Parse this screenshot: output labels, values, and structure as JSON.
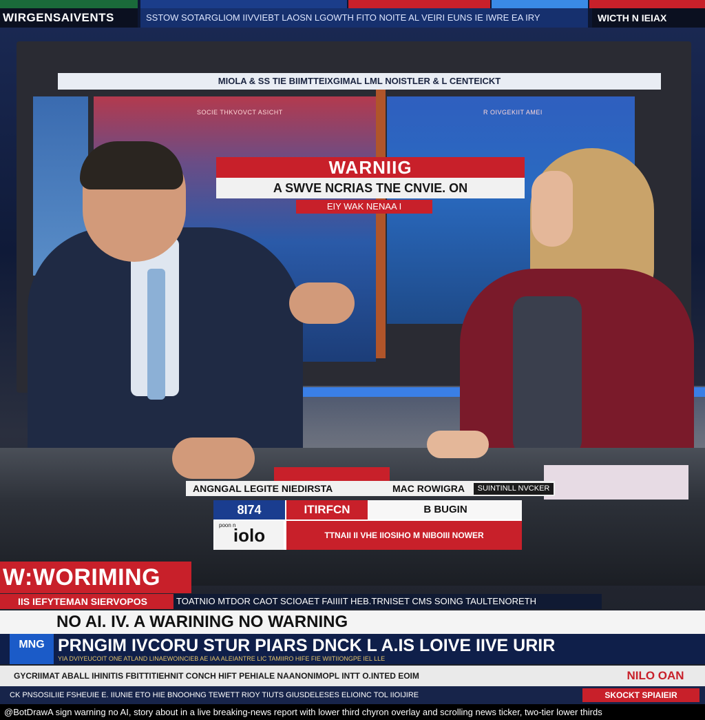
{
  "top_ticker": {
    "left": "WIRGENSAIVENTS",
    "middle": "SSTOW SOTARGLIOM IIVVIEBT LAOSN LGOWTH FITO NOITE AL VEIRI  EUNS IE IWRE EA IRY",
    "right": "WICTH N IEIAX"
  },
  "wall": {
    "banner": "MIOLA & SS TIE BIIMTTEIXGIMAL LML NOISTLER & L CENTEICKT",
    "left_screen_label": "SOCIE THKVOVCT ASICHT",
    "right_screen_label": "R OIVGEKIIT AMEI",
    "warning_title": "WARNIIG",
    "warning_sub": "A SWVE NCRIAS TNE CNVIE. ON",
    "warning_tag": "EIY WAK NENAA I"
  },
  "desk": {
    "name_left": "ANGNGAL LEGITE NIEDIRSTA",
    "name_mid": "MAC ROWIGRA",
    "name_right": "SUINTINLL NVCKER",
    "score_blue": "8I74",
    "score_red": "ITIRFCN",
    "score_white": "B BUGIN",
    "logo": "iolo",
    "logo_small": "poon n",
    "ticker": "TTNAII II VHE IIOSIHO M NIBOIII NOWER"
  },
  "lower_third": {
    "flag": "W:WORIMING",
    "row1_left": "IIS IEFYTEMAN SIERVOPOS",
    "row1_text": "TOATNIO MTDOR CAOT SCIOAET FAIIIIT HEB.TRNISET CMS SOING TAULTENORETH",
    "headline": "NO AI. IV. A WARINING  NO WARNING",
    "logo": "MNG",
    "main": "PRNGIM IVCORU STUR  PIARS DNCK L A.IS  LOIVE IIVE URIR",
    "main_sub": "YIA DVIYEUCOIT ONE ATLAND LINAEWOINCIEB AE IAA ALEIANTRE LIC TAMIIRO HIFE FIE  WIITIIONGPE IEL LLE",
    "ticker2": "GYCRIIMAT ABALL IHINITIS FBITTITIEHNIT CONCH HIFT PEHIALE NAANONIMOPL INTT O.INTED EOIM",
    "ticker2_badge": "NILO OAN",
    "crawl": "CK PNSOSILIIE FSHEUIE E. IIUNIE ETO HIE BNOOHNG TEWETT RIOY TIUTS GIUSDELESES ELIOINC TOL IIOIJIRE",
    "crawl_badge": "SKOCKT SPIAIEIR"
  },
  "caption": "@BotDrawA sign warning no AI, story about in a live breaking-news report with lower third chyron overlay and scrolling news ticker, two-tier lower thirds",
  "colors": {
    "brand_red": "#c8202a",
    "brand_blue": "#1a3d8f",
    "navy": "#0f1f4a"
  }
}
